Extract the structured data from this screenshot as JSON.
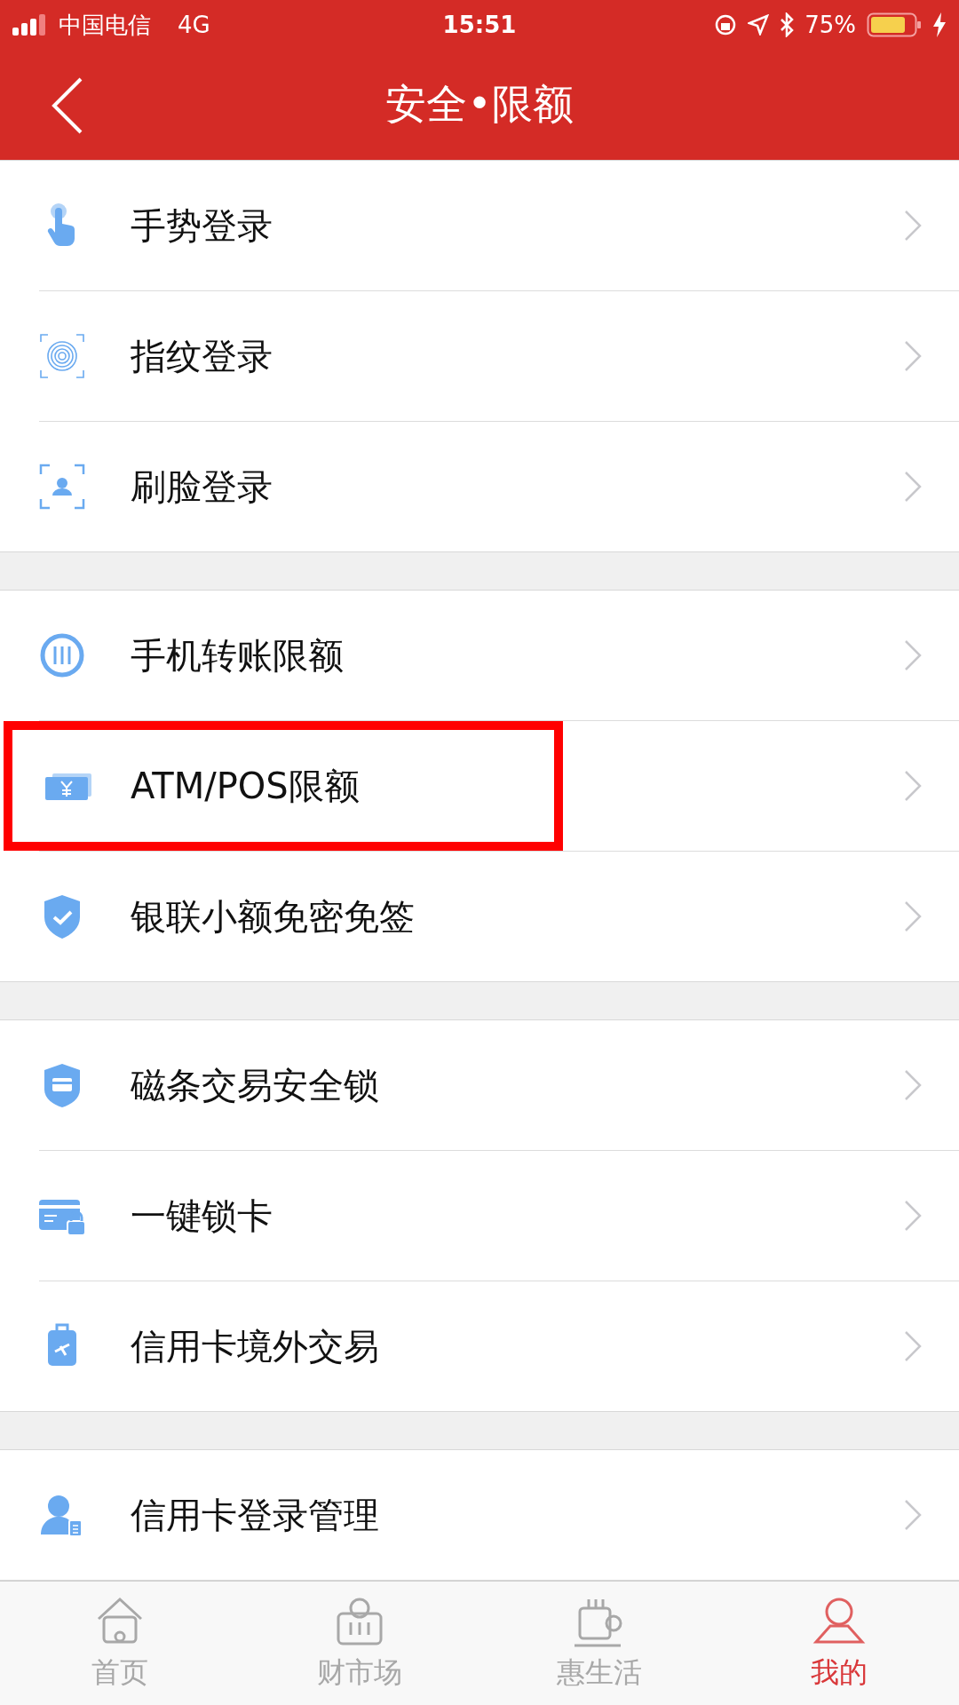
{
  "status_bar": {
    "carrier": "中国电信",
    "network": "4G",
    "time": "15:51",
    "battery": "75%"
  },
  "header": {
    "title": "安全•限额"
  },
  "groups": [
    {
      "items": [
        {
          "label": "手势登录",
          "highlighted": false
        },
        {
          "label": "指纹登录",
          "highlighted": false
        },
        {
          "label": "刷脸登录",
          "highlighted": false
        }
      ]
    },
    {
      "items": [
        {
          "label": "手机转账限额",
          "highlighted": false
        },
        {
          "label": "ATM/POS限额",
          "highlighted": true
        },
        {
          "label": "银联小额免密免签",
          "highlighted": false
        }
      ]
    },
    {
      "items": [
        {
          "label": "磁条交易安全锁",
          "highlighted": false
        },
        {
          "label": "一键锁卡",
          "highlighted": false
        },
        {
          "label": "信用卡境外交易",
          "highlighted": false
        }
      ]
    },
    {
      "items": [
        {
          "label": "信用卡登录管理",
          "highlighted": false
        }
      ]
    }
  ],
  "tab_bar": [
    {
      "label": "首页",
      "selected": false
    },
    {
      "label": "财市场",
      "selected": false
    },
    {
      "label": "惠生活",
      "selected": false
    },
    {
      "label": "我的",
      "selected": true
    }
  ]
}
